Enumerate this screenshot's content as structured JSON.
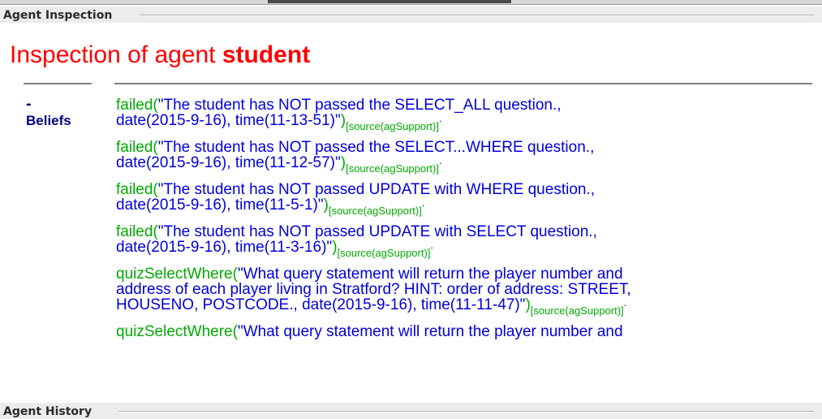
{
  "panels": {
    "inspection_title": "Agent Inspection",
    "history_title": "Agent History"
  },
  "header": {
    "prefix": "Inspection of agent ",
    "agent_name": "student"
  },
  "beliefs_section": {
    "toggle": "-",
    "label": "Beliefs"
  },
  "beliefs": [
    {
      "functor": "failed",
      "open": "(",
      "lines": [
        "\"The student has NOT passed the SELECT_ALL question.,",
        "date(2015-9-16), time(11-13-51)\""
      ],
      "close": ")",
      "source": "[source(agSupport)]",
      "dot": "."
    },
    {
      "functor": "failed",
      "open": "(",
      "lines": [
        "\"The student has NOT passed the SELECT...WHERE question.,",
        "date(2015-9-16), time(11-12-57)\""
      ],
      "close": ")",
      "source": "[source(agSupport)]",
      "dot": "."
    },
    {
      "functor": "failed",
      "open": "(",
      "lines": [
        "\"The student has NOT passed UPDATE with WHERE question.,",
        "date(2015-9-16), time(11-5-1)\""
      ],
      "close": ")",
      "source": "[source(agSupport)]",
      "dot": "."
    },
    {
      "functor": "failed",
      "open": "(",
      "lines": [
        "\"The student has NOT passed UPDATE with SELECT question.,",
        "date(2015-9-16), time(11-3-16)\""
      ],
      "close": ")",
      "source": "[source(agSupport)]",
      "dot": "."
    },
    {
      "functor": "quizSelectWhere",
      "open": "(",
      "lines": [
        "\"What query statement will return the player number and",
        "address of each player living in Stratford? HINT: order of address: STREET,",
        "HOUSENO, POSTCODE., date(2015-9-16), time(11-11-47)\""
      ],
      "close": ")",
      "source": "[source(agSupport)]",
      "dot": "."
    },
    {
      "functor": "quizSelectWhere",
      "open": "(",
      "lines": [
        "\"What query statement will return the player number and"
      ],
      "close": "",
      "source": "",
      "dot": ""
    }
  ],
  "colors": {
    "title_red": "#ff0000",
    "functor_green": "#00aa00",
    "term_blue": "#0000dd",
    "label_navy": "#000080"
  }
}
